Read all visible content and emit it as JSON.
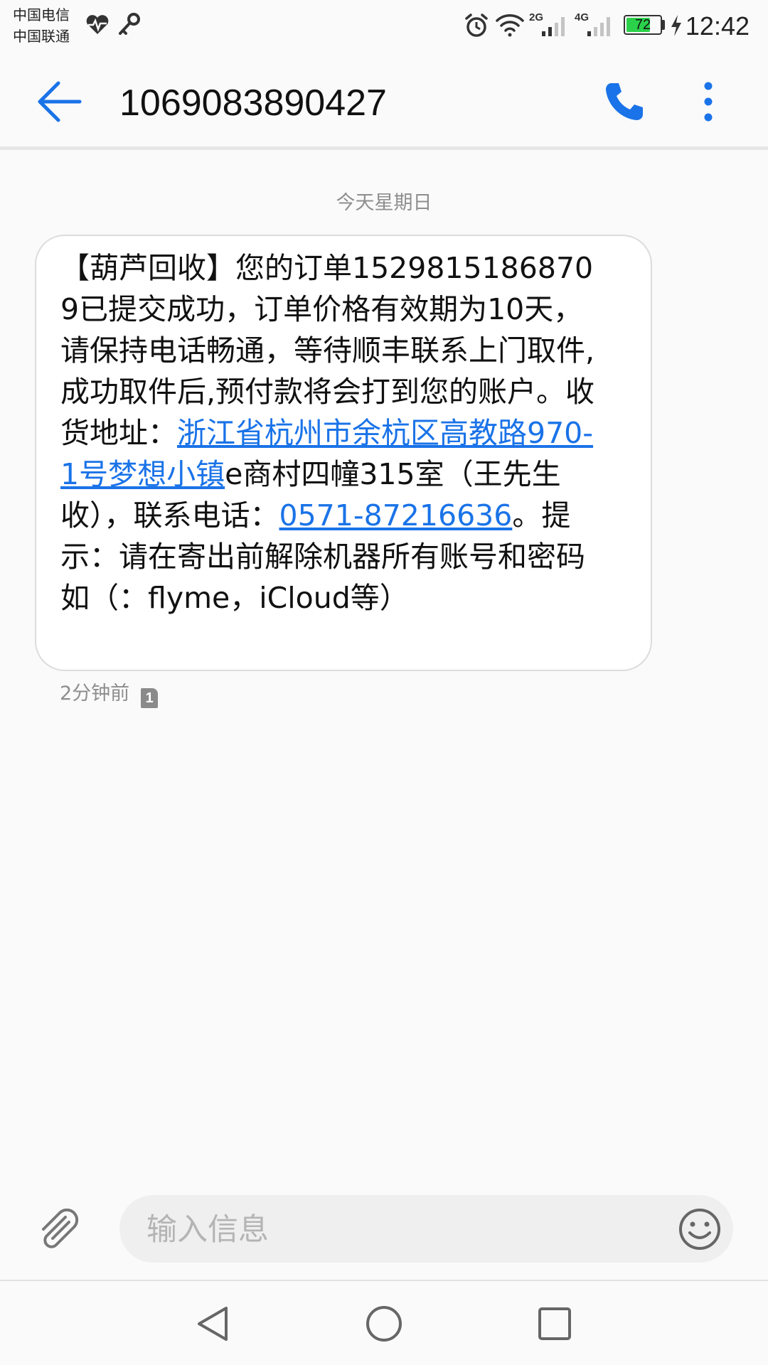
{
  "status_bar": {
    "carrier_1": "中国电信",
    "carrier_2": "中国联通",
    "signal_1_label": "2G",
    "signal_2_label": "4G",
    "battery_level": 72,
    "battery_text": "72",
    "time": "12:42",
    "icons": [
      "heartbeat-icon",
      "key-icon",
      "alarm-icon",
      "wifi-icon",
      "signal-icon",
      "charging-icon"
    ]
  },
  "header": {
    "title": "1069083890427",
    "icons": [
      "back-arrow-icon",
      "phone-icon",
      "more-vertical-icon"
    ]
  },
  "conversation": {
    "date_divider": "今天星期日",
    "message": {
      "segments": [
        {
          "text": "【葫芦回收】您的订单15298151868709已提交成功，订单价格有效期为10天，请保持电话畅通，等待顺丰联系上门取件,成功取件后,预付款将会打到您的账户。收货地址："
        },
        {
          "text": "浙江省杭州市余杭区高教路970-1号梦想小镇",
          "link": true
        },
        {
          "text": "e商村四幢315室（王先生收），联系电话："
        },
        {
          "text": "0571-87216636",
          "link": true
        },
        {
          "text": "。提示：请在寄出前解除机器所有账号和密码如（：flyme，iCloud等）"
        }
      ],
      "time": "2分钟前",
      "sim_slot": "1"
    }
  },
  "composer": {
    "placeholder": "输入信息",
    "icons": [
      "paperclip-icon",
      "emoji-icon"
    ]
  },
  "nav_bar": {
    "icons": [
      "nav-back-icon",
      "nav-home-icon",
      "nav-recents-icon"
    ]
  },
  "colors": {
    "accent": "#1a73e8",
    "battery": "#2bd14a",
    "bubble_border": "#dcdcdc",
    "composer_bg": "#efefef",
    "meta_text": "#8e8e8e"
  }
}
